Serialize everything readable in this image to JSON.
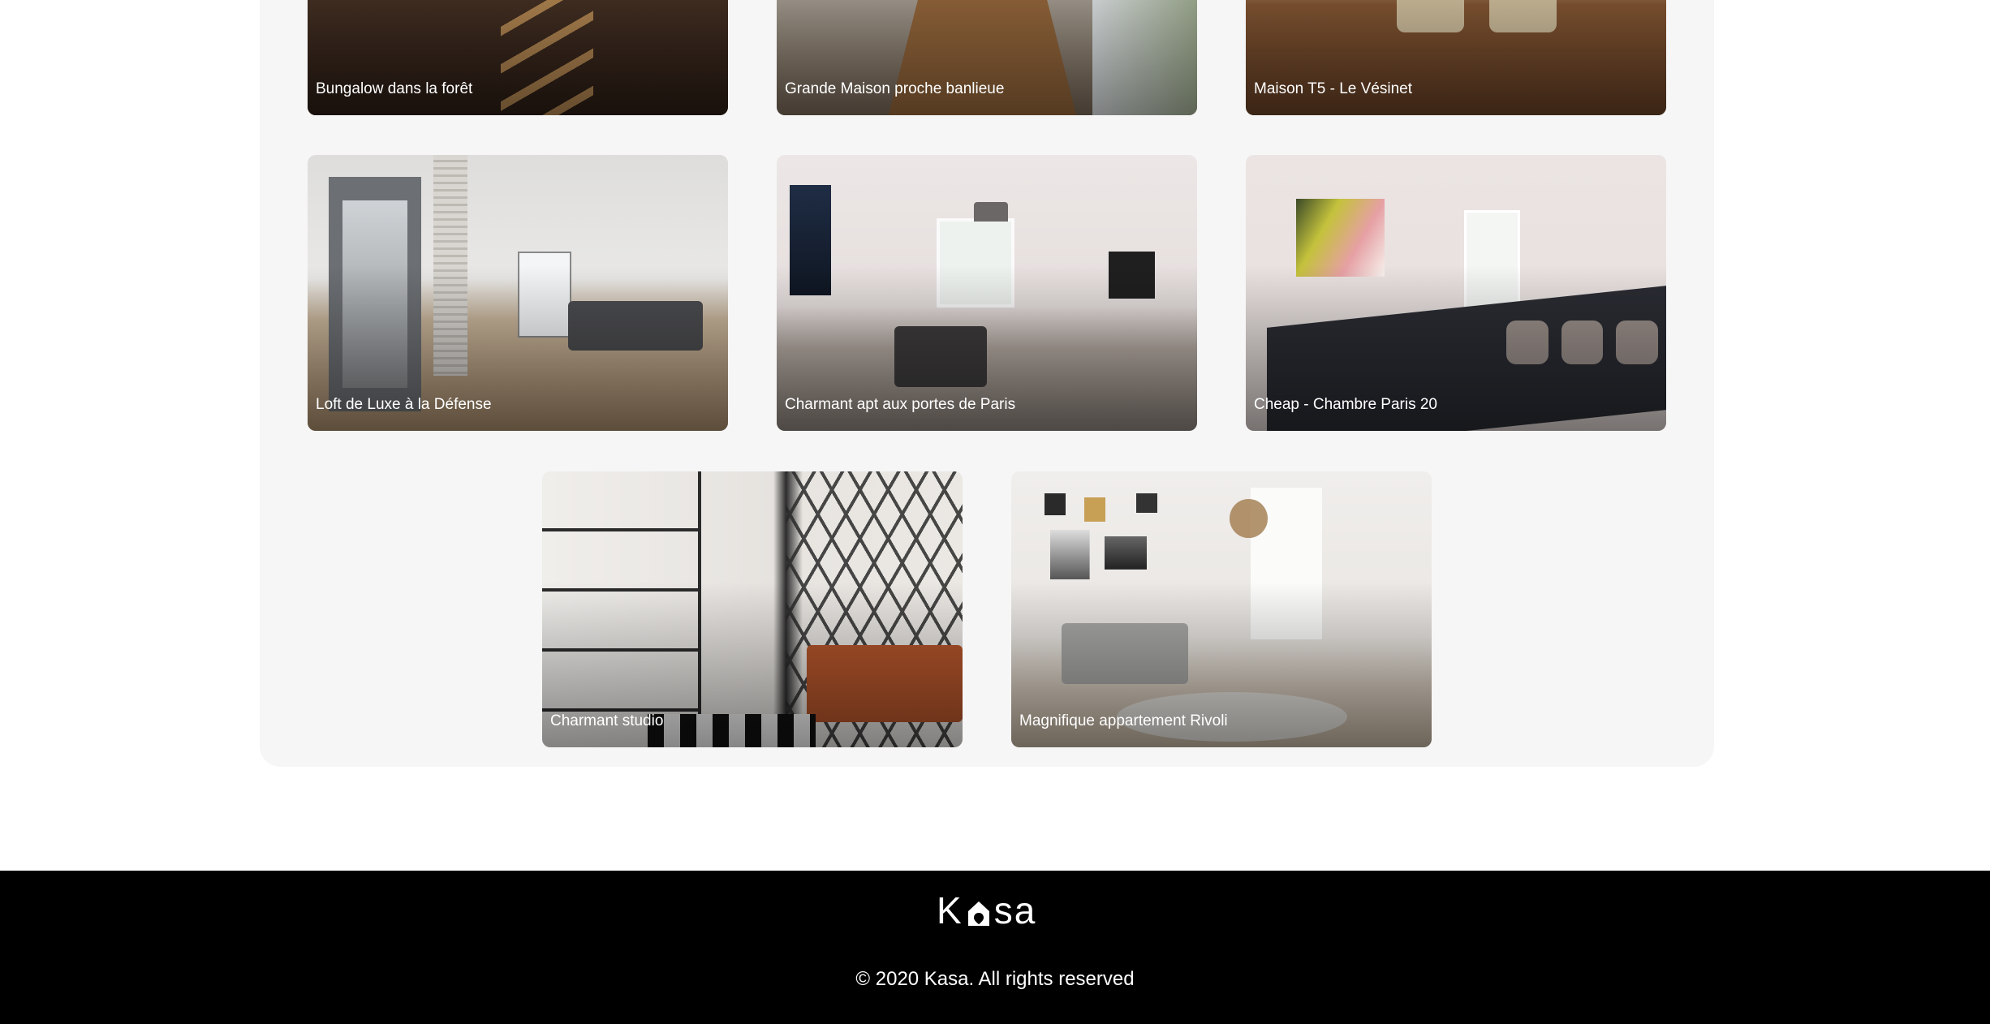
{
  "gallery": {
    "cards": [
      {
        "title": "Bungalow dans la forêt"
      },
      {
        "title": "Grande Maison proche banlieue"
      },
      {
        "title": "Maison T5 - Le Vésinet"
      },
      {
        "title": "Loft de Luxe à la Défense"
      },
      {
        "title": "Charmant apt aux portes de Paris"
      },
      {
        "title": "Cheap - Chambre Paris 20"
      },
      {
        "title": "Charmant studio"
      },
      {
        "title": "Magnifique appartement Rivoli"
      }
    ]
  },
  "footer": {
    "logo_left": "K",
    "logo_right": "sa",
    "logo_icon": "house-icon",
    "copyright": "© 2020 Kasa. All rights reserved"
  },
  "colors": {
    "footer_background": "#000000",
    "gallery_background": "#F6F6F6",
    "text_on_dark": "#FFFFFF"
  }
}
